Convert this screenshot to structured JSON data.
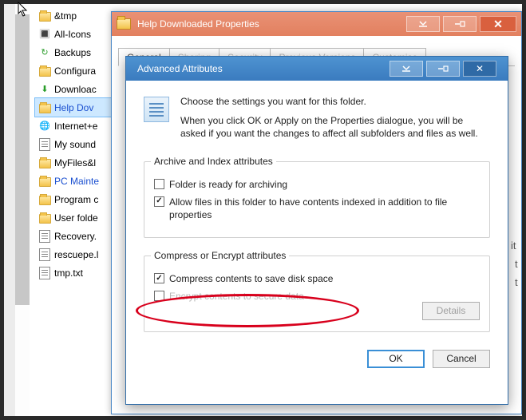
{
  "tree": {
    "items": [
      {
        "label": "&tmp",
        "type": "folder"
      },
      {
        "label": "All-Icons",
        "type": "icons"
      },
      {
        "label": "Backups",
        "type": "refresh"
      },
      {
        "label": "Configura",
        "type": "folder"
      },
      {
        "label": "Downloac",
        "type": "download"
      },
      {
        "label": "Help Dov",
        "type": "folder",
        "selected": true,
        "blue": true
      },
      {
        "label": "Internet+e",
        "type": "globe"
      },
      {
        "label": "My sound",
        "type": "doc"
      },
      {
        "label": "MyFiles&l",
        "type": "folder"
      },
      {
        "label": "PC Mainte",
        "type": "folder",
        "blue": true
      },
      {
        "label": "Program c",
        "type": "folder"
      },
      {
        "label": "User folde",
        "type": "folder"
      },
      {
        "label": "Recovery.",
        "type": "txt"
      },
      {
        "label": "rescuepe.l",
        "type": "txt"
      },
      {
        "label": "tmp.txt",
        "type": "txt"
      }
    ]
  },
  "props": {
    "title": "Help Downloaded Properties",
    "tabs": [
      "General",
      "Sharing",
      "Security",
      "Previous Versions",
      "Customise"
    ]
  },
  "adv": {
    "title": "Advanced Attributes",
    "intro1": "Choose the settings you want for this folder.",
    "intro2": "When you click OK or Apply on the Properties dialogue, you will be asked if you want the changes to affect all subfolders and files as well.",
    "group1": {
      "legend": "Archive and Index attributes",
      "opt1": {
        "label": "Folder is ready for archiving",
        "checked": false
      },
      "opt2": {
        "label": "Allow files in this folder to have contents indexed in addition to file properties",
        "checked": true
      }
    },
    "group2": {
      "legend": "Compress or Encrypt attributes",
      "opt1": {
        "label": "Compress contents to save disk space",
        "checked": true
      },
      "opt2": {
        "label": "Encrypt contents to secure data",
        "checked": false
      },
      "details": "Details"
    },
    "ok": "OK",
    "cancel": "Cancel"
  },
  "bg_letters": {
    "a": "it",
    "b": "t",
    "c": "t"
  }
}
